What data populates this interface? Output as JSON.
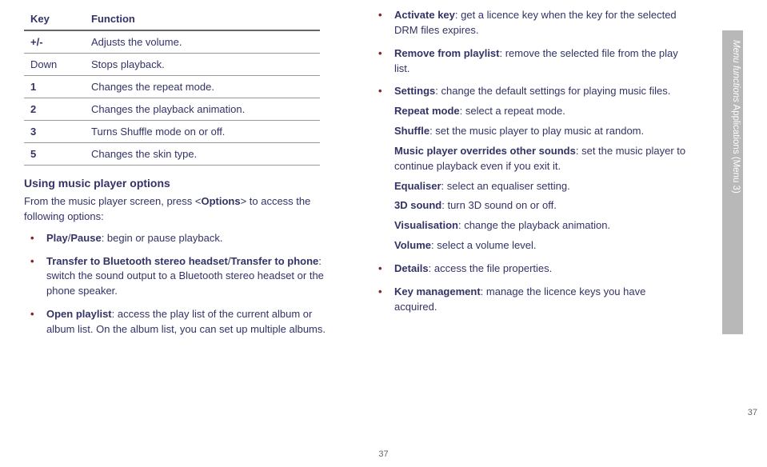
{
  "table": {
    "headers": {
      "key": "Key",
      "func": "Function"
    },
    "rows": [
      {
        "key": "+/-",
        "func": "Adjusts the volume."
      },
      {
        "key": "Down",
        "func": "Stops playback."
      },
      {
        "key": "1",
        "func": "Changes the repeat mode."
      },
      {
        "key": "2",
        "func": "Changes the playback animation."
      },
      {
        "key": "3",
        "func": "Turns Shuffle mode on or off."
      },
      {
        "key": "5",
        "func": "Changes the skin type."
      }
    ]
  },
  "heading1": "Using music player options",
  "intro_pre": "From the music player screen, press <",
  "intro_bold": "Options",
  "intro_post": "> to access the following options:",
  "bullets1": [
    {
      "term": "Play",
      "sep": "/",
      "term2": "Pause",
      "rest": ": begin or pause playback."
    },
    {
      "term": "Transfer to Bluetooth stereo headset",
      "sep": "/",
      "term2": "Transfer to phone",
      "rest": ": switch the sound output to a Bluetooth stereo headset or the phone speaker."
    },
    {
      "term": "Open playlist",
      "rest": ": access the play list of the current album or album list. On the album list, you can set up multiple albums."
    }
  ],
  "bullets2": [
    {
      "term": "Activate key",
      "rest": ": get a licence key when the key for the selected DRM files expires."
    },
    {
      "term": "Remove from playlist",
      "rest": ": remove the selected file from the play list."
    },
    {
      "term": "Settings",
      "rest": ": change the default settings for playing music files.",
      "subs": [
        {
          "t": "Repeat mode",
          "r": ": select a repeat mode."
        },
        {
          "t": "Shuffle",
          "r": ": set the music player to play music at random."
        },
        {
          "t": "Music player overrides other sounds",
          "r": ": set the music player to continue playback even if you exit it."
        },
        {
          "t": "Equaliser",
          "r": ": select an equaliser setting."
        },
        {
          "t": "3D sound",
          "r": ": turn 3D sound on or off."
        },
        {
          "t": "Visualisation",
          "r": ": change the playback animation."
        },
        {
          "t": "Volume",
          "r": ": select a volume level."
        }
      ]
    },
    {
      "term": "Details",
      "rest": ": access the file properties."
    },
    {
      "term": "Key management",
      "rest": ": manage the licence keys you have acquired."
    }
  ],
  "side": {
    "italic": "Menu functions",
    "plain": "    Applications (Menu 3)"
  },
  "page": "37"
}
